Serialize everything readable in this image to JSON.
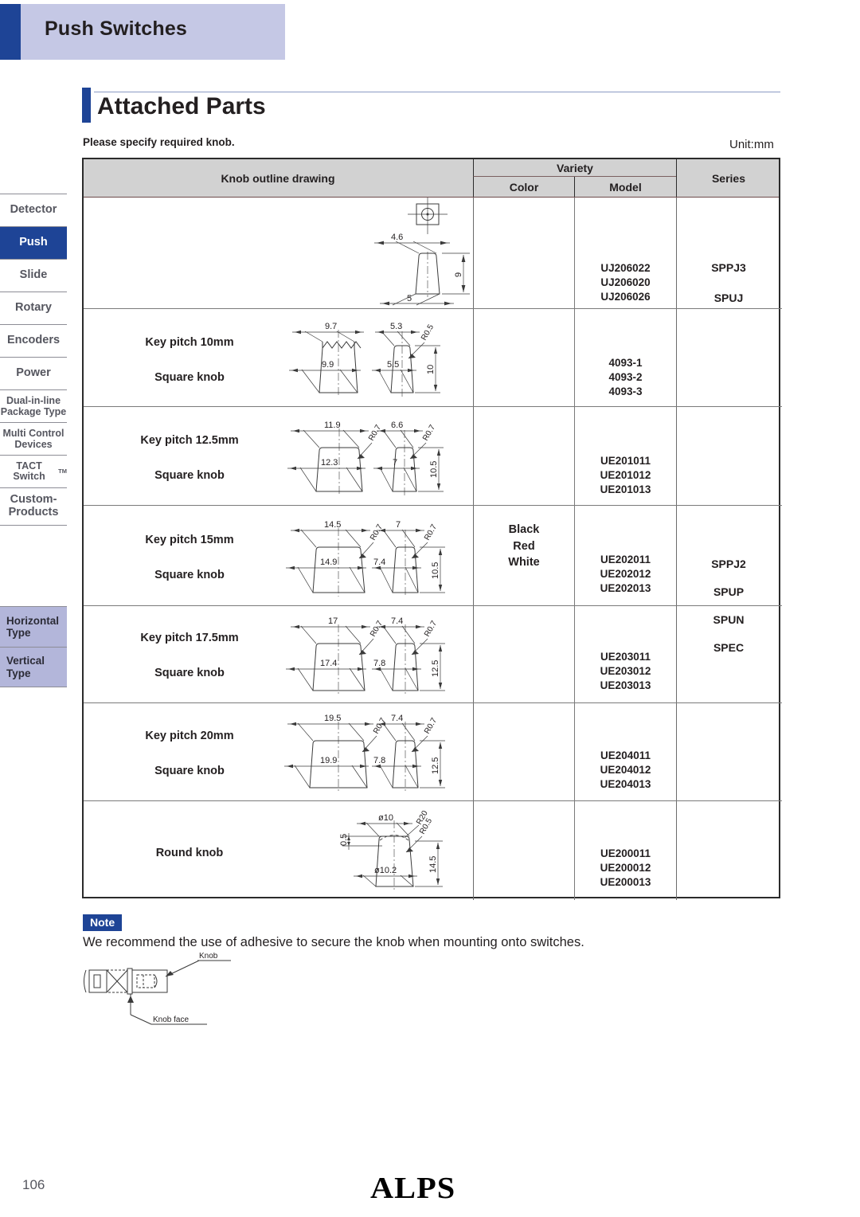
{
  "banner": {
    "title": "Push Switches"
  },
  "section": {
    "title": "Attached Parts",
    "instruction": "Please specify required knob.",
    "unit": "Unit:mm"
  },
  "sidebar": {
    "items": [
      {
        "label": "Detector",
        "active": false
      },
      {
        "label": "Push",
        "active": true
      },
      {
        "label": "Slide",
        "active": false
      },
      {
        "label": "Rotary",
        "active": false
      },
      {
        "label": "Encoders",
        "active": false
      },
      {
        "label": "Power",
        "active": false
      },
      {
        "label": "Dual-in-line Package Type",
        "active": false
      },
      {
        "label": "Multi Control Devices",
        "active": false
      },
      {
        "label": "TACT Switch",
        "sup": "TM",
        "active": false
      },
      {
        "label": "Custom- Products",
        "active": false
      }
    ],
    "highlight_items": [
      {
        "label": "Horizontal Type"
      },
      {
        "label": "Vertical Type"
      }
    ]
  },
  "table": {
    "headers": {
      "knob": "Knob outline drawing",
      "variety": "Variety",
      "color": "Color",
      "model": "Model",
      "series": "Series"
    },
    "color_group": "Black\nRed\nWhite",
    "color_lines": [
      "Black",
      "Red",
      "White"
    ],
    "rows": [
      {
        "label_line1": "",
        "label_line2": "",
        "models": [
          "UJ206022",
          "UJ206020",
          "UJ206026"
        ],
        "series": [
          "SPPJ3",
          "SPUJ"
        ],
        "dims": {
          "width_top": "4.6",
          "height": "9",
          "width_bottom": "5"
        }
      },
      {
        "label_line1": "Key pitch 10mm",
        "label_line2": "Square knob",
        "models": [
          "4093-1",
          "4093-2",
          "4093-3"
        ],
        "series": [],
        "dims": {
          "front_top": "9.7",
          "front_bottom": "9.9",
          "side_top": "5.3",
          "side_bottom": "5.5",
          "radius": "R0.5",
          "height": "10"
        }
      },
      {
        "label_line1": "Key pitch 12.5mm",
        "label_line2": "Square knob",
        "models": [
          "UE201011",
          "UE201012",
          "UE201013"
        ],
        "series": [],
        "dims": {
          "front_top": "11.9",
          "front_bottom": "12.3",
          "front_radius": "R0.7",
          "side_top": "6.6",
          "side_bottom": "7",
          "side_radius": "R0.7",
          "height": "10.5"
        }
      },
      {
        "label_line1": "Key pitch 15mm",
        "label_line2": "Square knob",
        "models": [
          "UE202011",
          "UE202012",
          "UE202013"
        ],
        "series": [],
        "dims": {
          "front_top": "14.5",
          "front_bottom": "14.9",
          "front_radius": "R0.7",
          "side_top": "7",
          "side_bottom": "7.4",
          "side_radius": "R0.7",
          "height": "10.5"
        }
      },
      {
        "label_line1": "Key pitch 17.5mm",
        "label_line2": "Square knob",
        "models": [
          "UE203011",
          "UE203012",
          "UE203013"
        ],
        "series": [],
        "dims": {
          "front_top": "17",
          "front_bottom": "17.4",
          "front_radius": "R0.7",
          "side_top": "7.4",
          "side_bottom": "7.8",
          "side_radius": "R0.7",
          "height": "12.5"
        }
      },
      {
        "label_line1": "Key pitch 20mm",
        "label_line2": "Square knob",
        "models": [
          "UE204011",
          "UE204012",
          "UE204013"
        ],
        "series": [],
        "dims": {
          "front_top": "19.5",
          "front_bottom": "19.9",
          "front_radius": "R0.7",
          "side_top": "7.4",
          "side_bottom": "7.8",
          "side_radius": "R0.7",
          "height": "12.5"
        }
      },
      {
        "label_line1": "Round knob",
        "label_line2": "",
        "models": [
          "UE200011",
          "UE200012",
          "UE200013"
        ],
        "series": [],
        "dims": {
          "dia_top": "ø10",
          "dia_bottom": "ø10.2",
          "radius_big": "R20",
          "radius_small": "R0.5",
          "depth": "0.5",
          "height": "14.5"
        }
      }
    ],
    "series_labels": [
      "SPPJ3",
      "SPUJ",
      "SPPJ2",
      "SPUP",
      "SPUN",
      "SPEC"
    ]
  },
  "note": {
    "tag": "Note",
    "text": "We recommend the use of adhesive to secure the knob when mounting onto switches.",
    "callout_knob": "Knob",
    "callout_knob_face": "Knob face"
  },
  "footer": {
    "page": "106",
    "logo": "ALPS"
  },
  "colors": {
    "accent": "#1e4496",
    "banner_bg": "#c5c8e5",
    "highlight": "#b3b6da",
    "header_fill": "#d2d2d2"
  }
}
